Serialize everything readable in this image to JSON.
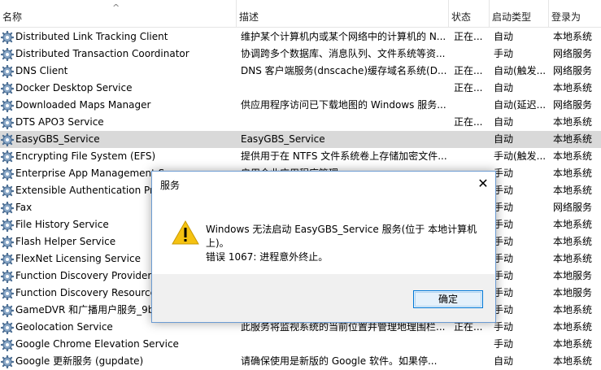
{
  "columns": {
    "name": "名称",
    "description": "描述",
    "status": "状态",
    "startup_type": "启动类型",
    "logon_as": "登录为"
  },
  "services": [
    {
      "name": "Distributed Link Tracking Client",
      "description": "维护某个计算机内或某个网络中的计算机的 N...",
      "status": "正在...",
      "startup": "自动",
      "logon": "本地系统"
    },
    {
      "name": "Distributed Transaction Coordinator",
      "description": "协调跨多个数据库、消息队列、文件系统等资...",
      "status": "",
      "startup": "手动",
      "logon": "网络服务"
    },
    {
      "name": "DNS Client",
      "description": "DNS 客户端服务(dnscache)缓存域名系统(D...",
      "status": "正在...",
      "startup": "自动(触发...",
      "logon": "网络服务"
    },
    {
      "name": "Docker Desktop Service",
      "description": "",
      "status": "正在...",
      "startup": "自动",
      "logon": "本地系统"
    },
    {
      "name": "Downloaded Maps Manager",
      "description": "供应用程序访问已下载地图的 Windows 服务...",
      "status": "",
      "startup": "自动(延迟...",
      "logon": "网络服务"
    },
    {
      "name": "DTS APO3 Service",
      "description": "",
      "status": "正在...",
      "startup": "自动",
      "logon": "本地系统"
    },
    {
      "name": "EasyGBS_Service",
      "description": "EasyGBS_Service",
      "status": "",
      "startup": "自动",
      "logon": "本地系统"
    },
    {
      "name": "Encrypting File System (EFS)",
      "description": "提供用于在 NTFS 文件系统卷上存储加密文件...",
      "status": "",
      "startup": "手动(触发...",
      "logon": "本地系统"
    },
    {
      "name": "Enterprise App Management S",
      "description": "启用企业应用程序管理",
      "status": "",
      "startup": "手动",
      "logon": "本地系统"
    },
    {
      "name": "Extensible Authentication Pro",
      "description": "",
      "status": "",
      "startup": "手动",
      "logon": "本地系统"
    },
    {
      "name": "Fax",
      "description": "",
      "status": "",
      "startup": "手动",
      "logon": "网络服务"
    },
    {
      "name": "File History Service",
      "description": "",
      "status": "",
      "startup": "手动",
      "logon": "本地系统"
    },
    {
      "name": "Flash Helper Service",
      "description": "",
      "status": "",
      "startup": "手动",
      "logon": "本地系统"
    },
    {
      "name": "FlexNet Licensing Service",
      "description": "",
      "status": "",
      "startup": "手动",
      "logon": "本地系统"
    },
    {
      "name": "Function Discovery Provider H",
      "description": "",
      "status": "",
      "startup": "手动",
      "logon": "本地服务"
    },
    {
      "name": "Function Discovery Resource",
      "description": "",
      "status": "",
      "startup": "手动",
      "logon": "本地服务"
    },
    {
      "name": "GameDVR 和广播用户服务_9b",
      "description": "",
      "status": "",
      "startup": "手动",
      "logon": "本地系统"
    },
    {
      "name": "Geolocation Service",
      "description": "此服务将监视系统的当前位置并管理地理围栏...",
      "status": "正在...",
      "startup": "手动",
      "logon": "本地系统"
    },
    {
      "name": "Google Chrome Elevation Service",
      "description": "",
      "status": "",
      "startup": "手动",
      "logon": "本地系统"
    },
    {
      "name": "Google 更新服务 (gupdate)",
      "description": "请确保使用是新版的 Google 软件。如果停...",
      "status": "",
      "startup": "自动",
      "logon": "本地系统"
    }
  ],
  "dialog": {
    "title": "服务",
    "message": "Windows 无法启动 EasyGBS_Service 服务(位于 本地计算机 上)。",
    "error": "错误 1067: 进程意外终止。",
    "ok_label": "确定",
    "close_glyph": "✕"
  },
  "icons": {
    "sort": "sort-ascending-icon",
    "service": "gear-icon",
    "warning": "warning-icon"
  },
  "colors": {
    "selected_row": "#d9d9d9",
    "dialog_border": "#6b9bd2",
    "ok_border": "#0078d7",
    "warning_fill": "#f5c211"
  },
  "selected_index": 6
}
